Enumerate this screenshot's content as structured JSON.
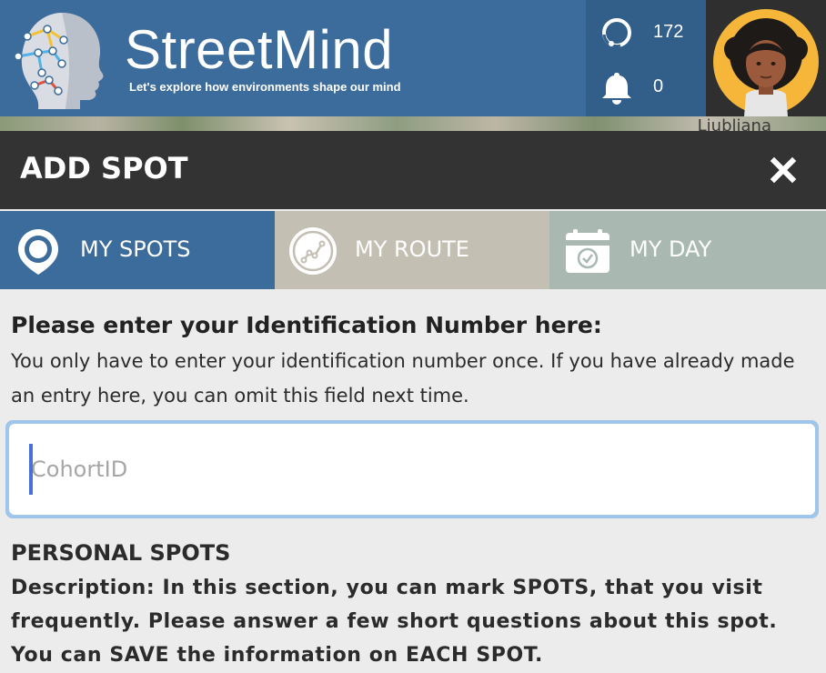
{
  "header": {
    "brand_name": "StreetMind",
    "tagline": "Let's explore how environments shape our mind",
    "points_count": "172",
    "notification_count": "0",
    "map_label": "Ljubljana"
  },
  "titlebar": {
    "title": "ADD SPOT"
  },
  "tabs": [
    {
      "label": "MY SPOTS",
      "icon": "location-pin-icon"
    },
    {
      "label": "MY ROUTE",
      "icon": "route-icon"
    },
    {
      "label": "MY DAY",
      "icon": "calendar-icon"
    }
  ],
  "identification": {
    "heading": "Please enter your Identification Number here:",
    "hint": "You only have to enter your identification number once. If you have already made an entry here, you can omit this field next time.",
    "input_placeholder": "CohortID",
    "input_value": ""
  },
  "personal_spots": {
    "heading": "PERSONAL SPOTS",
    "description": "Description: In this section, you can mark SPOTS, that you visit frequently. Please answer a few short questions about this spot. You can SAVE the information on EACH SPOT."
  },
  "colors": {
    "header_blue": "#3c6c9b",
    "titlebar_dark": "#333333",
    "tab_route": "#c4bfb3",
    "tab_day": "#a9b9b2",
    "input_focus": "#9dc6ea"
  }
}
